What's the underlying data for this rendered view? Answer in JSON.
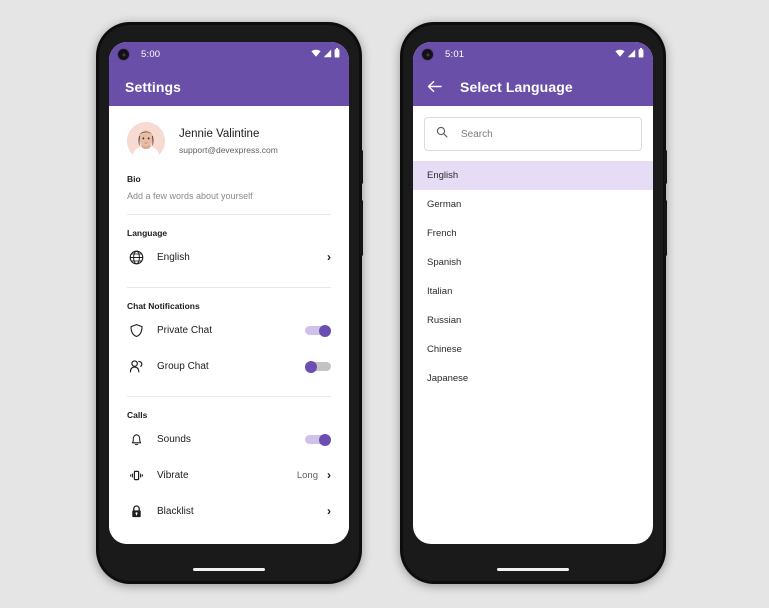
{
  "theme": {
    "primary": "#6a4fa8",
    "accent": "#6b4fb0",
    "selected_row": "#e6dcf5",
    "page_background": "#e5e5e5"
  },
  "phone_left": {
    "status_bar": {
      "time": "5:00",
      "icons": [
        "wifi-icon",
        "cellular-signal-icon",
        "battery-icon"
      ]
    },
    "appbar": {
      "title": "Settings"
    },
    "profile": {
      "name": "Jennie Valintine",
      "email": "support@devexpress.com",
      "avatar": "user-avatar"
    },
    "bio": {
      "label": "Bio",
      "placeholder": "Add a few words about yourself"
    },
    "sections": [
      {
        "title": "Language",
        "rows": [
          {
            "icon": "globe-icon",
            "label": "English",
            "type": "chevron"
          }
        ]
      },
      {
        "title": "Chat Notifications",
        "rows": [
          {
            "icon": "shield-icon",
            "label": "Private Chat",
            "type": "toggle",
            "state": "on"
          },
          {
            "icon": "group-icon",
            "label": "Group Chat",
            "type": "toggle",
            "state": "off"
          }
        ]
      },
      {
        "title": "Calls",
        "rows": [
          {
            "icon": "bell-icon",
            "label": "Sounds",
            "type": "toggle",
            "state": "on"
          },
          {
            "icon": "vibrate-icon",
            "label": "Vibrate",
            "type": "chevron",
            "value": "Long"
          },
          {
            "icon": "lock-icon",
            "label": "Blacklist",
            "type": "chevron"
          }
        ]
      }
    ]
  },
  "phone_right": {
    "status_bar": {
      "time": "5:01",
      "icons": [
        "wifi-icon",
        "cellular-signal-icon",
        "battery-icon"
      ]
    },
    "appbar": {
      "back": "back-arrow-icon",
      "title": "Select Language"
    },
    "search": {
      "icon": "search-icon",
      "placeholder": "Search",
      "value": ""
    },
    "languages": [
      {
        "label": "English",
        "selected": true
      },
      {
        "label": "German",
        "selected": false
      },
      {
        "label": "French",
        "selected": false
      },
      {
        "label": "Spanish",
        "selected": false
      },
      {
        "label": "Italian",
        "selected": false
      },
      {
        "label": "Russian",
        "selected": false
      },
      {
        "label": "Chinese",
        "selected": false
      },
      {
        "label": "Japanese",
        "selected": false
      }
    ]
  }
}
